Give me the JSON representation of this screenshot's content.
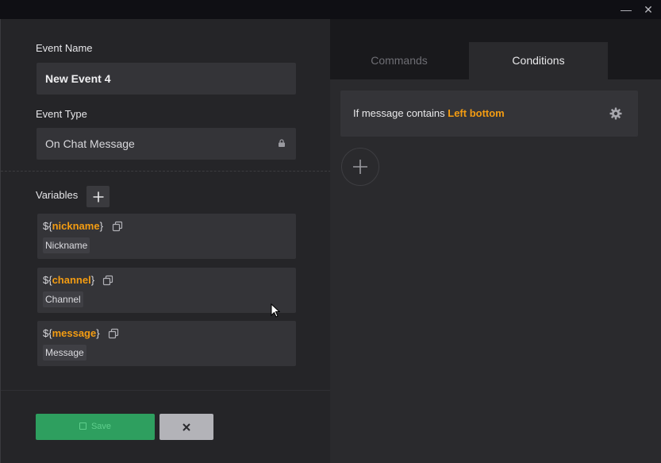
{
  "window": {
    "minimize": "—",
    "close": "✕"
  },
  "form": {
    "event_name_label": "Event Name",
    "event_name_value": "New Event 4",
    "event_type_label": "Event Type",
    "event_type_value": "On Chat Message",
    "variables_label": "Variables"
  },
  "variables": [
    {
      "prefix": "${",
      "name": "nickname",
      "suffix": "}",
      "desc": "Nickname"
    },
    {
      "prefix": "${",
      "name": "channel",
      "suffix": "}",
      "desc": "Channel"
    },
    {
      "prefix": "${",
      "name": "message",
      "suffix": "}",
      "desc": "Message"
    }
  ],
  "actions": {
    "save_label": "Save",
    "cancel_label": "✕"
  },
  "tabs": {
    "commands": "Commands",
    "conditions": "Conditions",
    "active": "conditions"
  },
  "condition": {
    "prefix": "If message contains",
    "value": "Left bottom"
  },
  "colors": {
    "accent": "#f39c12",
    "save": "#2e9f5f",
    "cancel": "#b3b3b8"
  }
}
